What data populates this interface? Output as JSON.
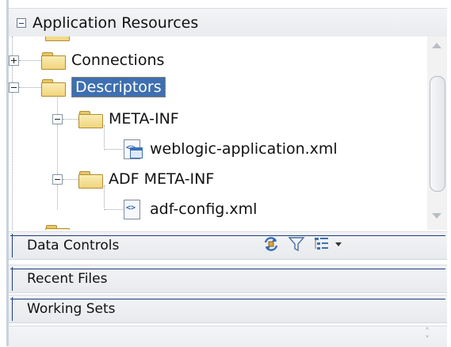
{
  "header": {
    "title": "Application Resources"
  },
  "tree": {
    "nodes": [
      {
        "label": "Connections",
        "kind": "folder",
        "expanded": false
      },
      {
        "label": "Descriptors",
        "kind": "folder",
        "expanded": true,
        "selected": true
      },
      {
        "label": "META-INF",
        "kind": "folder",
        "expanded": true
      },
      {
        "label": "weblogic-application.xml",
        "kind": "file",
        "icon": "xml-config-file-icon"
      },
      {
        "label": "ADF META-INF",
        "kind": "folder",
        "expanded": true
      },
      {
        "label": "adf-config.xml",
        "kind": "file",
        "icon": "xml-file-icon"
      }
    ]
  },
  "sections": [
    {
      "label": "Data Controls",
      "tools": [
        "refresh-icon",
        "filter-icon",
        "layout-options-icon"
      ]
    },
    {
      "label": "Recent Files"
    },
    {
      "label": "Working Sets"
    }
  ],
  "colors": {
    "selection": "#3e6fb0",
    "folder": "#f0d57e",
    "panel": "#eceef1"
  }
}
